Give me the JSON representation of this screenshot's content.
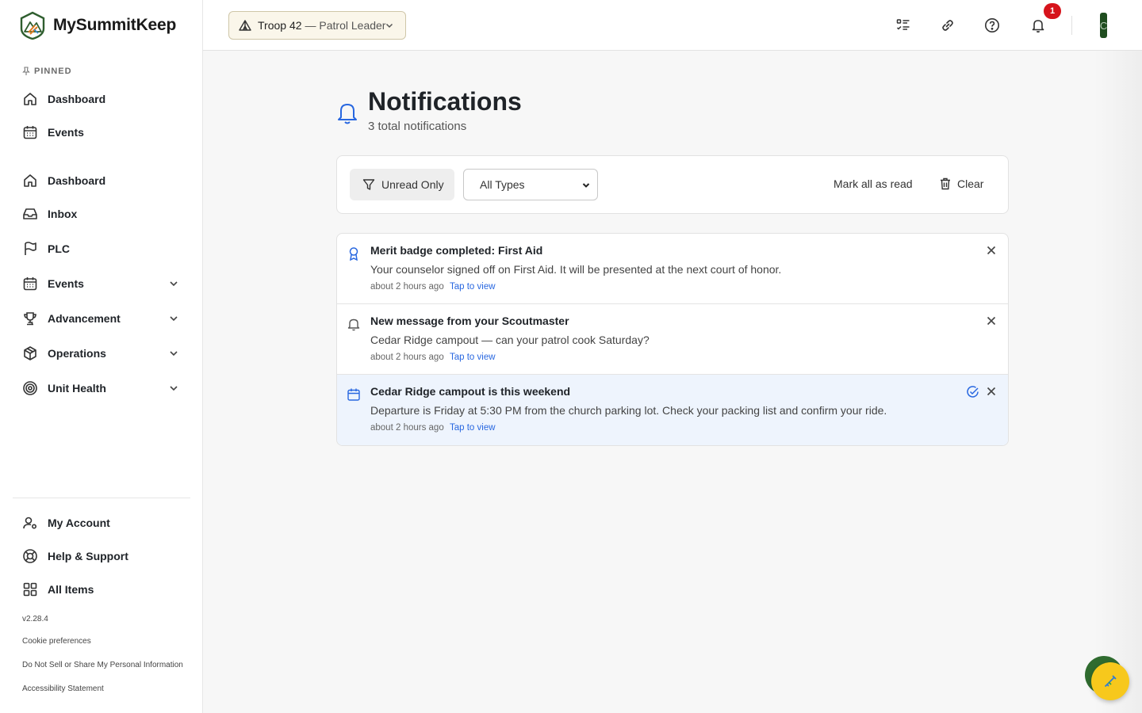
{
  "app": {
    "name": "MySummitKeep",
    "version": "v2.28.4"
  },
  "sidebar": {
    "pinned_label": "PINNED",
    "pinned": [
      {
        "label": "Dashboard",
        "icon": "home-icon"
      },
      {
        "label": "Events",
        "icon": "calendar-icon"
      }
    ],
    "items": [
      {
        "label": "Dashboard",
        "icon": "home-icon",
        "expandable": false
      },
      {
        "label": "Inbox",
        "icon": "inbox-icon",
        "expandable": false
      },
      {
        "label": "PLC",
        "icon": "flag-icon",
        "expandable": false
      },
      {
        "label": "Events",
        "icon": "calendar-icon",
        "expandable": true
      },
      {
        "label": "Advancement",
        "icon": "trophy-icon",
        "expandable": true
      },
      {
        "label": "Operations",
        "icon": "package-icon",
        "expandable": true
      },
      {
        "label": "Unit Health",
        "icon": "target-icon",
        "expandable": true
      }
    ],
    "bottom": [
      {
        "label": "My Account",
        "icon": "user-settings-icon"
      },
      {
        "label": "Help & Support",
        "icon": "lifebuoy-icon"
      },
      {
        "label": "All Items",
        "icon": "grid-icon"
      }
    ],
    "footer_links": [
      "Cookie preferences",
      "Do Not Sell or Share My Personal Information",
      "Accessibility Statement"
    ]
  },
  "header": {
    "unit_name": "Troop 42",
    "unit_role": "— Patrol Leader",
    "notification_count": "1",
    "avatar_initial": "C",
    "icons": [
      "checklist-icon",
      "link-icon",
      "help-circle-icon",
      "bell-icon"
    ]
  },
  "page": {
    "title": "Notifications",
    "subtitle": "3 total notifications"
  },
  "toolbar": {
    "unread_only_label": "Unread Only",
    "type_filter_value": "All Types",
    "mark_all_read_label": "Mark all as read",
    "clear_label": "Clear"
  },
  "notifications": [
    {
      "title": "Merit badge completed: First Aid",
      "body": "Your counselor signed off on First Aid. It will be presented at the next court of honor.",
      "time": "about 2 hours ago",
      "link": "Tap to view",
      "icon": "award-icon",
      "unread": false
    },
    {
      "title": "New message from your Scoutmaster",
      "body": "Cedar Ridge campout — can your patrol cook Saturday?",
      "time": "about 2 hours ago",
      "link": "Tap to view",
      "icon": "bell-icon",
      "unread": false
    },
    {
      "title": "Cedar Ridge campout is this weekend",
      "body": "Departure is Friday at 5:30 PM from the church parking lot. Check your packing list and confirm your ride.",
      "time": "about 2 hours ago",
      "link": "Tap to view",
      "icon": "calendar-icon",
      "unread": true
    }
  ],
  "colors": {
    "accent": "#2867e0",
    "badge": "#d6131b",
    "unread_bg": "#eef4fd",
    "brand_green": "#2f6b2f",
    "fab": "#f7c81c"
  },
  "fab": {
    "icon": "test-tube-icon"
  }
}
